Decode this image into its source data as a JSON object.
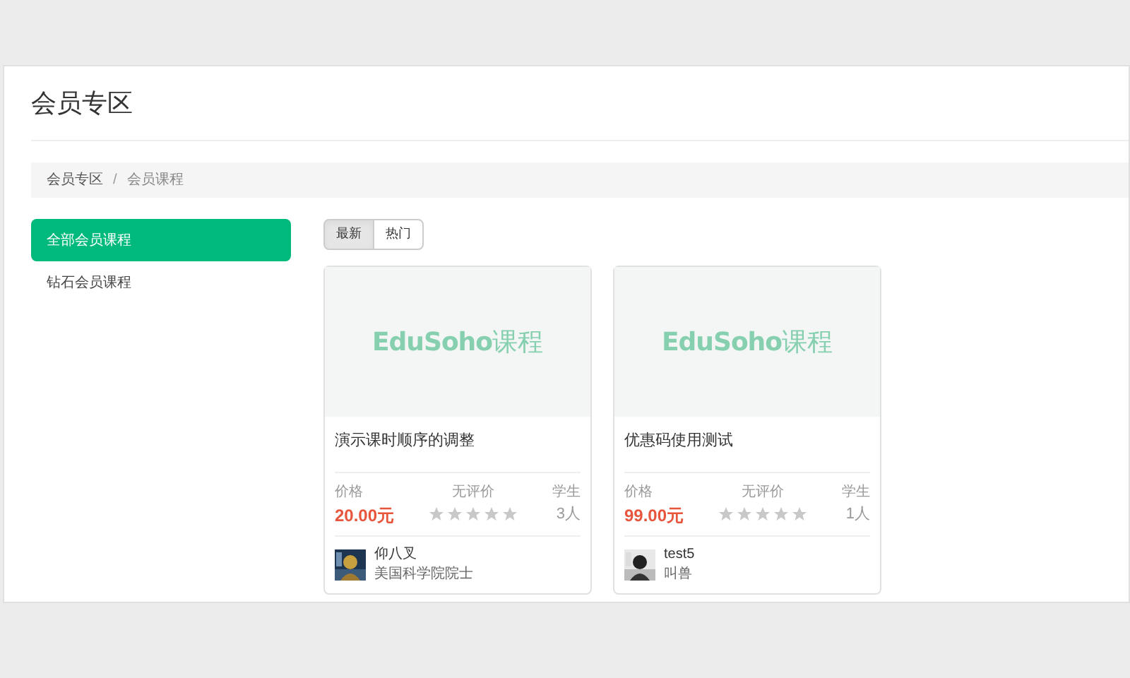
{
  "page_title": "会员专区",
  "breadcrumb": [
    {
      "label": "会员专区"
    },
    {
      "label": "会员课程"
    }
  ],
  "breadcrumb_separator": "/",
  "sidebar": {
    "items": [
      {
        "label": "全部会员课程",
        "selected": true
      },
      {
        "label": "钻石会员课程",
        "selected": false
      }
    ]
  },
  "sort_tabs": [
    {
      "label": "最新",
      "selected": true
    },
    {
      "label": "热门",
      "selected": false
    }
  ],
  "courses": [
    {
      "cover_brand": "EduSoho",
      "cover_word": "课程",
      "title": "演示课时顺序的调整",
      "price_label": "价格",
      "price": "20.00元",
      "rating_label": "无评价",
      "stars": 0,
      "students_label": "学生",
      "students": "3人",
      "teacher": {
        "name": "仰八叉",
        "title": "美国科学院院士"
      }
    },
    {
      "cover_brand": "EduSoho",
      "cover_word": "课程",
      "title": "优惠码使用测试",
      "price_label": "价格",
      "price": "99.00元",
      "rating_label": "无评价",
      "stars": 0,
      "students_label": "学生",
      "students": "1人",
      "teacher": {
        "name": "test5",
        "title": "叫兽"
      }
    }
  ]
}
